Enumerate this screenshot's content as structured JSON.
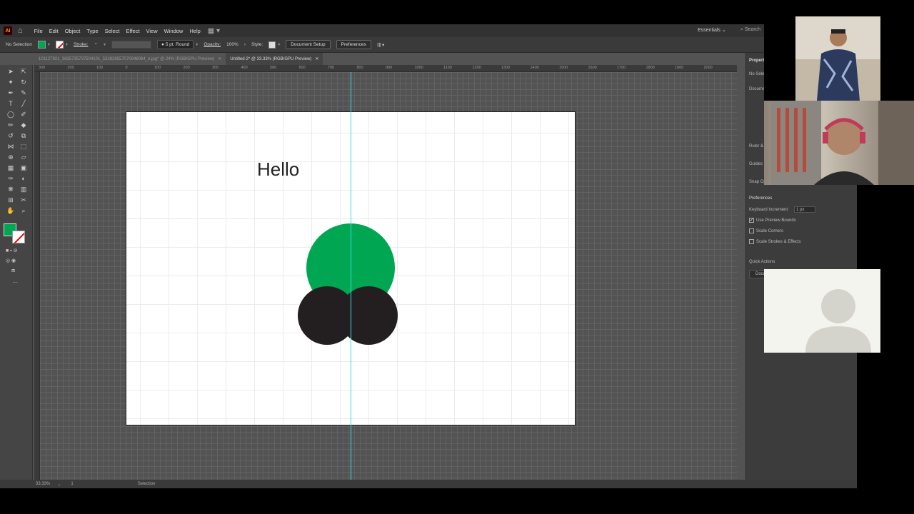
{
  "app": {
    "logo": "Ai",
    "menus": [
      "File",
      "Edit",
      "Object",
      "Type",
      "Select",
      "Effect",
      "View",
      "Window",
      "Help"
    ],
    "workspace": "Essentials",
    "search_placeholder": "Search"
  },
  "control_bar": {
    "selection_status": "No Selection",
    "stroke_label": "Stroke:",
    "brush": "5 pt. Round",
    "opacity_label": "Opacity:",
    "opacity_value": "100%",
    "style_label": "Style:",
    "document_setup": "Document Setup",
    "preferences": "Preferences",
    "colors": {
      "fill": "#00a651"
    }
  },
  "tabs": [
    {
      "label": "101127921_3825735737504101_532828557070948064_o.jpg* @ 24% (RGB/GPU Preview)",
      "active": false
    },
    {
      "label": "Untitled-2* @ 33.33% (RGB/GPU Preview)",
      "active": true
    }
  ],
  "ruler_labels": [
    "300",
    "200",
    "100",
    "0",
    "100",
    "200",
    "300",
    "400",
    "500",
    "600",
    "700",
    "800",
    "900",
    "1000",
    "1100",
    "1200",
    "1300",
    "1400",
    "1500",
    "1600",
    "1700",
    "1800",
    "1900",
    "2000"
  ],
  "artboard": {
    "text": "Hello",
    "colors": {
      "green_circle": "#00a651",
      "dark_circle": "#231f20",
      "guide": "#33e0e8"
    }
  },
  "status_bar": {
    "zoom": "33.33%",
    "artboard_number": "1",
    "tool": "Selection"
  },
  "properties_panel": {
    "title": "Properties",
    "no_selection": "No Selection",
    "document": "Document",
    "rulers_grids": "Ruler & Grids",
    "guides": "Guides",
    "snap_options": "Snap Options",
    "preferences_heading": "Preferences",
    "keyboard_increment_label": "Keyboard Increment:",
    "keyboard_increment_value": "1 px",
    "use_preview_bounds": "Use Preview Bounds",
    "scale_corners": "Scale Corners",
    "scale_strokes": "Scale Strokes & Effects",
    "quick_actions": "Quick Actions",
    "doc_setup_short": "Document Setup"
  }
}
